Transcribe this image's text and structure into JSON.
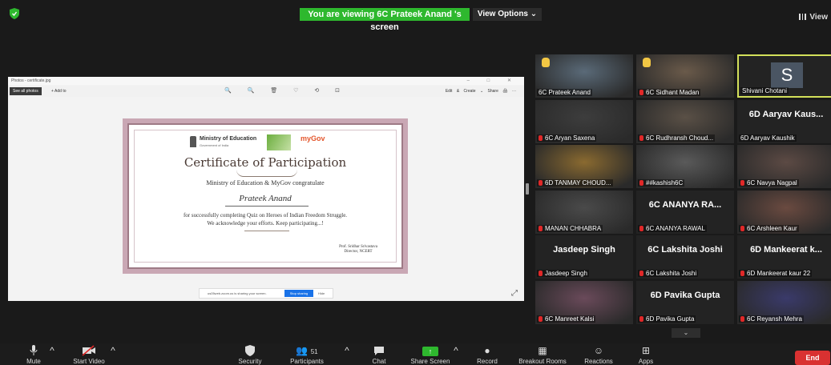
{
  "banner": {
    "text": "You are viewing 6C Prateek Anand 's screen"
  },
  "view_options": {
    "label": "View Options ⌄"
  },
  "view_top": {
    "label": "View"
  },
  "shared_window": {
    "title": "Photos - certificate.jpg",
    "controls": "– □ ✕",
    "toolbar": {
      "see_all": "See all photos",
      "add_to": "+ Add to",
      "center_icons": "🔍 🔍 🗑 ♡ ⟲ ⊡",
      "right": "Edit & Create ⌄  Share  🖨  ···"
    },
    "certificate": {
      "org": "Ministry of Education",
      "org_sub": "Government of India",
      "mygov": "myGov",
      "title": "Certificate of Participation",
      "line1": "Ministry of Education & MyGov congratulate",
      "name": "Prateek Anand",
      "line2": "for successfully completing Quiz on Heroes of Indian Freedom Struggle.",
      "line3": "We acknowledge your efforts. Keep participating...!",
      "signer": "Prof. Sridhar Srivastava",
      "signer_title": "Director, NCERT"
    },
    "share_bar": {
      "text": "us05web.zoom.us is sharing your screen.",
      "stop": "Stop sharing",
      "hide": "Hide"
    }
  },
  "participants": [
    {
      "caption": "6C Prateek Anand",
      "raised_hand": true
    },
    {
      "caption": "6C Sidhant Madan",
      "raised_hand": true,
      "muted": true
    },
    {
      "caption": "Shivani Chotani",
      "avatar": "S",
      "active": true
    },
    {
      "caption": "6C Aryan Saxena",
      "muted": true
    },
    {
      "caption": "6C Rudhransh Choud...",
      "muted": true
    },
    {
      "caption": "6D Aaryav Kaushik",
      "big": "6D Aaryav Kaus..."
    },
    {
      "caption": "6D TANMAY CHOUD...",
      "muted": true
    },
    {
      "caption": "##kashish6C",
      "muted": true
    },
    {
      "caption": "6C Navya Nagpal",
      "muted": true
    },
    {
      "caption": "MANAN CHHABRA",
      "muted": true
    },
    {
      "caption": "6C ANANYA RAWAL",
      "big": "6C ANANYA RA...",
      "muted": true
    },
    {
      "caption": "6C Arshleen Kaur",
      "muted": true
    },
    {
      "caption": "Jasdeep Singh",
      "big": "Jasdeep Singh",
      "muted": true
    },
    {
      "caption": "6C Lakshita Joshi",
      "big": "6C Lakshita Joshi",
      "muted": true
    },
    {
      "caption": "6D Mankeerat kaur 22",
      "big": "6D Mankeerat k...",
      "muted": true
    },
    {
      "caption": "6C Manreet Kalsi",
      "muted": true
    },
    {
      "caption": "6D Pavika Gupta",
      "big": "6D Pavika Gupta",
      "muted": true
    },
    {
      "caption": "6C Reyansh Mehra",
      "muted": true
    }
  ],
  "toolbar": {
    "mute": "Mute",
    "start_video": "Start Video",
    "security": "Security",
    "participants": "Participants",
    "participants_count": "51",
    "chat": "Chat",
    "share_screen": "Share Screen",
    "record": "Record",
    "breakout": "Breakout Rooms",
    "reactions": "Reactions",
    "apps": "Apps",
    "end": "End"
  },
  "colors": {
    "banner": "#2eb82e",
    "end": "#d93131",
    "active_border": "#d3e05a",
    "mute_red": "#e02828"
  }
}
